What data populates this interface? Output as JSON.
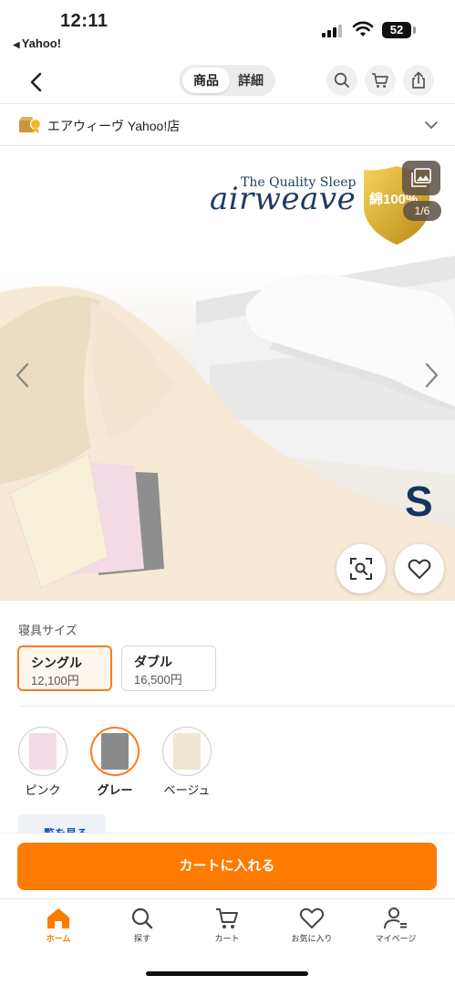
{
  "status_bar": {
    "time": "12:11",
    "back_app": "Yahoo!",
    "battery": "52"
  },
  "header": {
    "tabs": [
      {
        "label": "商品",
        "active": true
      },
      {
        "label": "詳細",
        "active": false
      }
    ],
    "icons": [
      "back-chevron-icon",
      "search-icon",
      "cart-icon",
      "share-icon"
    ]
  },
  "store": {
    "name": "エアウィーヴ Yahoo!店"
  },
  "hero": {
    "brand_sub": "The Quality Sleep",
    "brand_main": "airweave",
    "badge_text": "綿100%",
    "image_counter": "1/6",
    "size_letter": "S",
    "product_colors": {
      "beige": "#f6edd8",
      "pink": "#f3dbe6",
      "gray": "#8d8d8d"
    }
  },
  "options": {
    "size_label": "寝具サイズ",
    "sizes": [
      {
        "name": "シングル",
        "price": "12,100円",
        "selected": true
      },
      {
        "name": "ダブル",
        "price": "16,500円",
        "selected": false
      }
    ],
    "colors": [
      {
        "name": "ピンク",
        "swatch": "#f3dbe6",
        "selected": false
      },
      {
        "name": "グレー",
        "swatch": "#8a8a8a",
        "selected": true
      },
      {
        "name": "ベージュ",
        "swatch": "#f0e6d4",
        "selected": false
      }
    ],
    "more_label": "覧を見る"
  },
  "cart": {
    "button_label": "カートに入れる"
  },
  "tabbar": {
    "items": [
      {
        "label": "ホーム",
        "icon": "home-icon",
        "active": true
      },
      {
        "label": "探す",
        "icon": "search-icon",
        "active": false
      },
      {
        "label": "カート",
        "icon": "cart-icon",
        "active": false
      },
      {
        "label": "お気に入り",
        "icon": "heart-icon",
        "active": false
      },
      {
        "label": "マイページ",
        "icon": "user-icon",
        "active": false
      }
    ]
  },
  "colors": {
    "accent": "#ff7a00",
    "brand_navy": "#1e3a5f",
    "link": "#1a56b0"
  }
}
